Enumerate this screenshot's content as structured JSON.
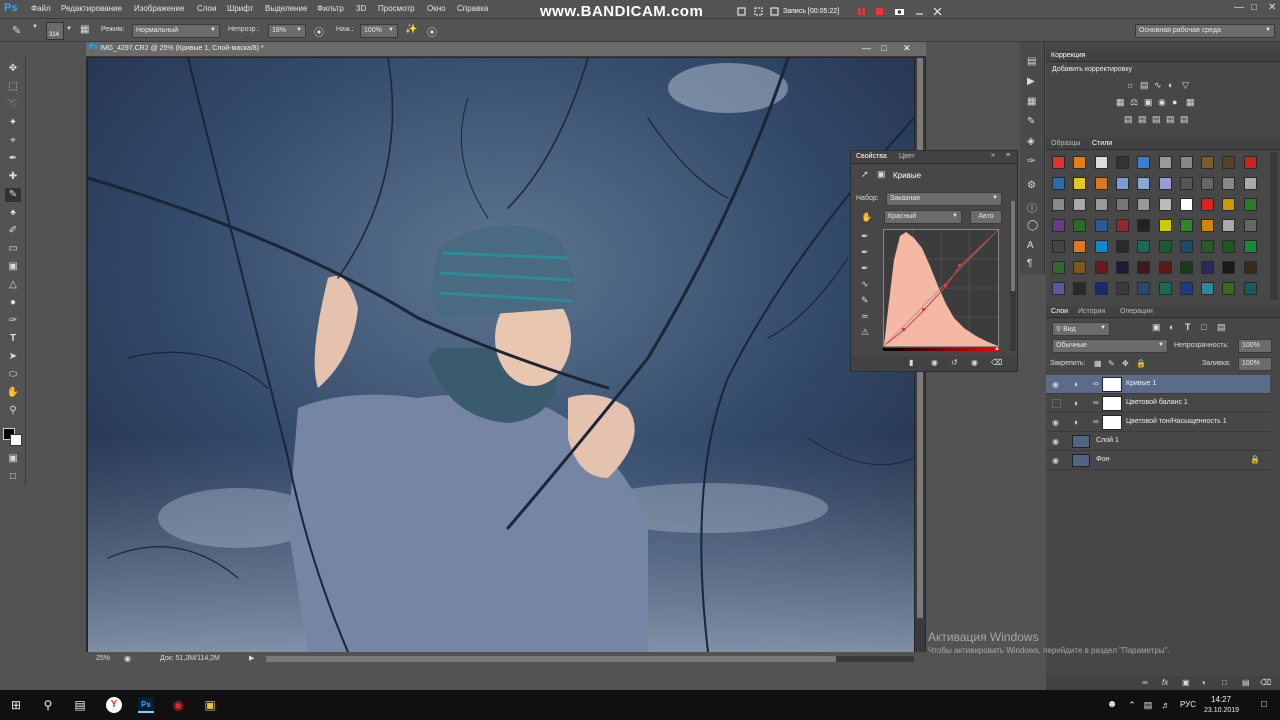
{
  "app": {
    "logo": "Ps"
  },
  "menu": [
    "Файл",
    "Редактирование",
    "Изображение",
    "Слои",
    "Шрифт",
    "Выделение",
    "Фильтр",
    "3D",
    "Просмотр",
    "Окно",
    "Справка"
  ],
  "bandicam": {
    "brand": "www.BANDICAM.com",
    "recording": "Запись [00:05:22]"
  },
  "options_bar": {
    "brush_size": "314",
    "mode_label": "Режим:",
    "mode_value": "Нормальный",
    "opacity_label": "Непрозр.:",
    "opacity_value": "18%",
    "pressure_label": "Наж.:",
    "pressure_value": "100%",
    "workspace": "Основная рабочая среда"
  },
  "document": {
    "title": "IMG_4297.CR2 @ 25% (Кривые 1, Слой-маска/8) *",
    "zoom": "25%",
    "doc_info": "Док: 51,3M/114,2M"
  },
  "properties": {
    "tabs": [
      "Свойства",
      "Цвет"
    ],
    "title": "Кривые",
    "preset_label": "Набор:",
    "preset_value": "Заказная",
    "channel_value": "Красный",
    "auto_button": "Авто"
  },
  "correction": {
    "tab": "Коррекция",
    "subtitle": "Добавить корректировку"
  },
  "styles_panel": {
    "tabs": [
      "Образцы",
      "Стили"
    ]
  },
  "layers_panel": {
    "tabs": [
      "Слои",
      "История",
      "Операции"
    ],
    "filter_value": "Вид",
    "blend_mode": "Обычные",
    "opacity_label": "Непрозрачность:",
    "opacity_value": "100%",
    "lock_label": "Закрепить:",
    "fill_label": "Заливка:",
    "fill_value": "100%",
    "layers": [
      {
        "name": "Кривые 1",
        "selected": true,
        "type": "adjustment",
        "visible": true
      },
      {
        "name": "Цветовой баланс 1",
        "selected": false,
        "type": "adjustment",
        "visible": false
      },
      {
        "name": "Цветовой тон/Насыщенность 1",
        "selected": false,
        "type": "adjustment",
        "visible": true
      },
      {
        "name": "Слой 1",
        "selected": false,
        "type": "pixel",
        "visible": true
      },
      {
        "name": "Фон",
        "selected": false,
        "type": "background",
        "visible": true,
        "locked": true
      }
    ]
  },
  "watermark": {
    "title": "Активация Windows",
    "subtitle": "Чтобы активировать Windows, перейдите в раздел \"Параметры\"."
  },
  "taskbar": {
    "lang": "РУС",
    "time": "14:27",
    "date": "23.10.2019"
  },
  "colors": {
    "panel": "#535353",
    "dark_panel": "#474747",
    "selection": "#5d6b8a",
    "curve_histogram": "#f4b8a4",
    "curve_line": "#d44040"
  }
}
